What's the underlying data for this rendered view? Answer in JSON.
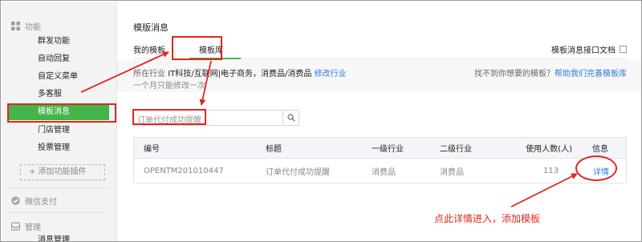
{
  "sidebar": {
    "section_function": "功能",
    "items": [
      {
        "label": "群发功能"
      },
      {
        "label": "自动回复"
      },
      {
        "label": "自定义菜单"
      },
      {
        "label": "多客服"
      },
      {
        "label": "模板消息",
        "active": true
      },
      {
        "label": "门店管理"
      },
      {
        "label": "投票管理"
      }
    ],
    "add_plugin": "+ 添加功能插件",
    "section_pay": "微信支付",
    "section_manage": "管理",
    "cut_item": "消息管理"
  },
  "main": {
    "title": "模版消息",
    "tabs": [
      {
        "label": "我的模板"
      },
      {
        "label": "模板库",
        "active": true
      }
    ],
    "doc_link": "模板消息接口文档",
    "industry": {
      "prefix": "所在行业",
      "value": "IT科技/互联网|电子商务，消费品/消费品",
      "edit_link": "修改行业",
      "note": "一个月只能修改一次",
      "hint": "找不到你想要的模板？",
      "help_link": "帮助我们完善模板库"
    },
    "search": {
      "value": "订单代付成功提醒"
    },
    "table": {
      "headers": [
        "编号",
        "标题",
        "一级行业",
        "二级行业",
        "使用人数(人)",
        "信息"
      ],
      "rows": [
        [
          "OPENTM201010447",
          "订单代付成功提醒",
          "消费品",
          "消费品",
          "113",
          "详情"
        ]
      ]
    }
  },
  "annotation": {
    "text": "点此详情进入，添加模板",
    "color": "#e0281f"
  },
  "colors": {
    "accent": "#44b549",
    "link": "#2e7dd6",
    "annotation": "#e0281f"
  }
}
